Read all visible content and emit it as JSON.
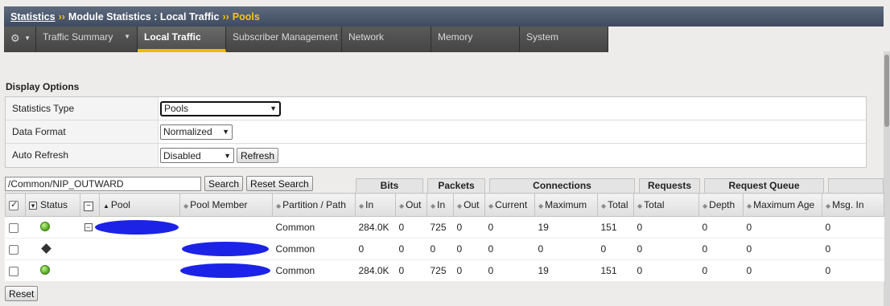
{
  "breadcrumb": {
    "root": "Statistics",
    "sep": "››",
    "middle": "Module Statistics : Local Traffic",
    "current": "Pools"
  },
  "tabs": [
    {
      "label": "",
      "icon": "gear-icon",
      "has_menu": true
    },
    {
      "label": "Traffic Summary",
      "has_menu": true
    },
    {
      "label": "Local Traffic",
      "active": true
    },
    {
      "label": "Subscriber Management"
    },
    {
      "label": "Network"
    },
    {
      "label": "Memory"
    },
    {
      "label": "System"
    }
  ],
  "display_options": {
    "title": "Display Options",
    "statistics_type": {
      "label": "Statistics Type",
      "value": "Pools"
    },
    "data_format": {
      "label": "Data Format",
      "value": "Normalized"
    },
    "auto_refresh": {
      "label": "Auto Refresh",
      "value": "Disabled",
      "refresh_button": "Refresh"
    }
  },
  "search": {
    "value": "/Common/NIP_OUTWARD",
    "search_button": "Search",
    "reset_search_button": "Reset Search"
  },
  "column_groups": [
    "Bits",
    "Packets",
    "Connections",
    "Requests",
    "Request Queue"
  ],
  "columns": [
    "Status",
    "Pool",
    "Pool Member",
    "Partition / Path",
    "In",
    "Out",
    "In",
    "Out",
    "Current",
    "Maximum",
    "Total",
    "Total",
    "Depth",
    "Maximum Age",
    "Msg. In"
  ],
  "rows": [
    {
      "status": "available",
      "pool": "[redacted]",
      "member": "",
      "partition": "Common",
      "bits_in": "284.0K",
      "bits_out": "0",
      "pkts_in": "725",
      "pkts_out": "0",
      "conn_current": "0",
      "conn_max": "19",
      "conn_total": "151",
      "req_total": "0",
      "rq_depth": "0",
      "rq_max_age": "0",
      "msg_in": "0"
    },
    {
      "status": "unknown",
      "pool": "",
      "member": "[redacted]",
      "partition": "Common",
      "bits_in": "0",
      "bits_out": "0",
      "pkts_in": "0",
      "pkts_out": "0",
      "conn_current": "0",
      "conn_max": "0",
      "conn_total": "0",
      "req_total": "0",
      "rq_depth": "0",
      "rq_max_age": "0",
      "msg_in": "0"
    },
    {
      "status": "available",
      "pool": "",
      "member": "[redacted]",
      "partition": "Common",
      "bits_in": "284.0K",
      "bits_out": "0",
      "pkts_in": "725",
      "pkts_out": "0",
      "conn_current": "0",
      "conn_max": "19",
      "conn_total": "151",
      "req_total": "0",
      "rq_depth": "0",
      "rq_max_age": "0",
      "msg_in": "0"
    }
  ],
  "reset_button": "Reset",
  "colors": {
    "accent": "#f5b800",
    "header_bg": "#4a5568",
    "available": "#4fa31b"
  }
}
